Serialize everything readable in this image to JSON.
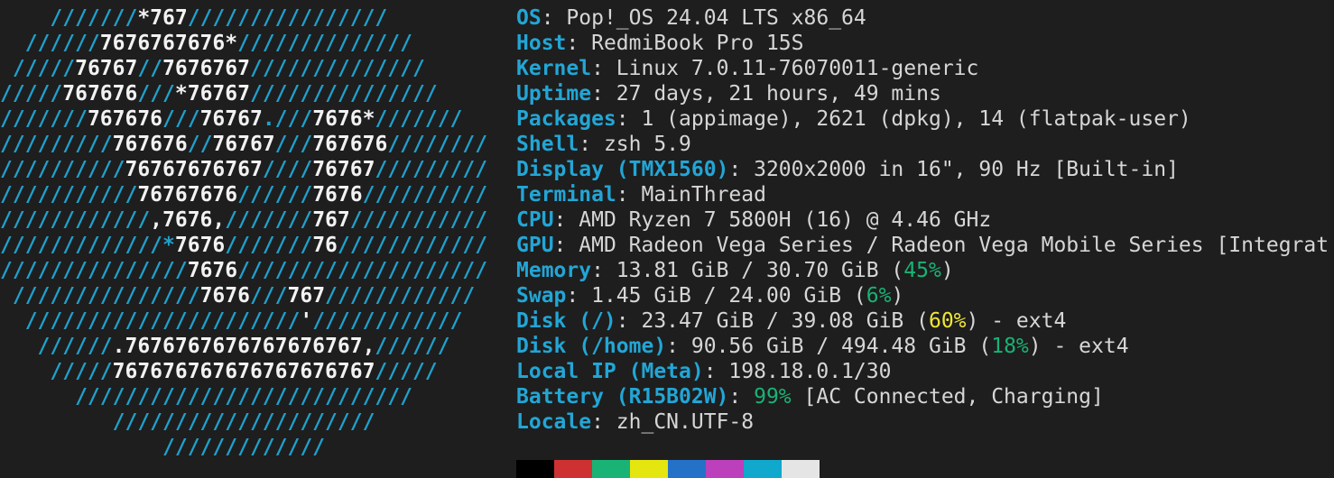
{
  "logo": {
    "lines": [
      [
        {
          "t": "    ///////",
          "c": "c"
        },
        {
          "t": "*767",
          "c": "w"
        },
        {
          "t": "////////////////",
          "c": "c"
        }
      ],
      [
        {
          "t": "  //////",
          "c": "c"
        },
        {
          "t": "7676767676*",
          "c": "w"
        },
        {
          "t": "//////////////",
          "c": "c"
        }
      ],
      [
        {
          "t": " /////",
          "c": "c"
        },
        {
          "t": "76767",
          "c": "w"
        },
        {
          "t": "//",
          "c": "c"
        },
        {
          "t": "7676767",
          "c": "w"
        },
        {
          "t": "//////////////",
          "c": "c"
        }
      ],
      [
        {
          "t": "/////",
          "c": "c"
        },
        {
          "t": "767676",
          "c": "w"
        },
        {
          "t": "///",
          "c": "c"
        },
        {
          "t": "*76767",
          "c": "w"
        },
        {
          "t": "///////////////",
          "c": "c"
        }
      ],
      [
        {
          "t": "///////",
          "c": "c"
        },
        {
          "t": "767676",
          "c": "w"
        },
        {
          "t": "///",
          "c": "c"
        },
        {
          "t": "76767",
          "c": "w"
        },
        {
          "t": ".///",
          "c": "c"
        },
        {
          "t": "7676*",
          "c": "w"
        },
        {
          "t": "///////",
          "c": "c"
        }
      ],
      [
        {
          "t": "/////////",
          "c": "c"
        },
        {
          "t": "767676",
          "c": "w"
        },
        {
          "t": "//",
          "c": "c"
        },
        {
          "t": "76767",
          "c": "w"
        },
        {
          "t": "///",
          "c": "c"
        },
        {
          "t": "767676",
          "c": "w"
        },
        {
          "t": "////////",
          "c": "c"
        }
      ],
      [
        {
          "t": "//////////",
          "c": "c"
        },
        {
          "t": "76767676767",
          "c": "w"
        },
        {
          "t": "////",
          "c": "c"
        },
        {
          "t": "76767",
          "c": "w"
        },
        {
          "t": "/////////",
          "c": "c"
        }
      ],
      [
        {
          "t": "///////////",
          "c": "c"
        },
        {
          "t": "76767676",
          "c": "w"
        },
        {
          "t": "//////",
          "c": "c"
        },
        {
          "t": "7676",
          "c": "w"
        },
        {
          "t": "//////////",
          "c": "c"
        }
      ],
      [
        {
          "t": "////////////",
          "c": "c"
        },
        {
          "t": ",7676,",
          "c": "w"
        },
        {
          "t": "///////",
          "c": "c"
        },
        {
          "t": "767",
          "c": "w"
        },
        {
          "t": "///////////",
          "c": "c"
        }
      ],
      [
        {
          "t": "/////////////",
          "c": "c"
        },
        {
          "t": "*",
          "c": "c"
        },
        {
          "t": "7676",
          "c": "w"
        },
        {
          "t": "///////",
          "c": "c"
        },
        {
          "t": "76",
          "c": "w"
        },
        {
          "t": "////////////",
          "c": "c"
        }
      ],
      [
        {
          "t": "///////////////",
          "c": "c"
        },
        {
          "t": "7676",
          "c": "w"
        },
        {
          "t": "////////////////////",
          "c": "c"
        }
      ],
      [
        {
          "t": " ///////////////",
          "c": "c"
        },
        {
          "t": "7676",
          "c": "w"
        },
        {
          "t": "///",
          "c": "c"
        },
        {
          "t": "767",
          "c": "w"
        },
        {
          "t": "////////////",
          "c": "c"
        }
      ],
      [
        {
          "t": "  //////////////////////",
          "c": "c"
        },
        {
          "t": "'",
          "c": "w"
        },
        {
          "t": "////////////",
          "c": "c"
        }
      ],
      [
        {
          "t": "   //////",
          "c": "c"
        },
        {
          "t": ".7676767676767676767,",
          "c": "w"
        },
        {
          "t": "//////",
          "c": "c"
        }
      ],
      [
        {
          "t": "    /////",
          "c": "c"
        },
        {
          "t": "767676767676767676767",
          "c": "w"
        },
        {
          "t": "/////",
          "c": "c"
        }
      ],
      [
        {
          "t": "      ///////////////////////////",
          "c": "c"
        }
      ],
      [
        {
          "t": "         /////////////////////",
          "c": "c"
        }
      ],
      [
        {
          "t": "             /////////////",
          "c": "c"
        }
      ]
    ]
  },
  "info": [
    {
      "key": "OS",
      "value": [
        {
          "t": "Pop!_OS 24.04 LTS x86_64"
        }
      ]
    },
    {
      "key": "Host",
      "value": [
        {
          "t": "RedmiBook Pro 15S"
        }
      ]
    },
    {
      "key": "Kernel",
      "value": [
        {
          "t": "Linux 7.0.11-76070011-generic"
        }
      ]
    },
    {
      "key": "Uptime",
      "value": [
        {
          "t": "27 days, 21 hours, 49 mins"
        }
      ]
    },
    {
      "key": "Packages",
      "value": [
        {
          "t": "1 (appimage), 2621 (dpkg), 14 (flatpak-user)"
        }
      ]
    },
    {
      "key": "Shell",
      "value": [
        {
          "t": "zsh 5.9"
        }
      ]
    },
    {
      "key": "Display (TMX1560)",
      "value": [
        {
          "t": "3200x2000 in 16\", 90 Hz [Built-in]"
        }
      ]
    },
    {
      "key": "Terminal",
      "value": [
        {
          "t": "MainThread"
        }
      ]
    },
    {
      "key": "CPU",
      "value": [
        {
          "t": "AMD Ryzen 7 5800H (16) @ 4.46 GHz"
        }
      ]
    },
    {
      "key": "GPU",
      "value": [
        {
          "t": "AMD Radeon Vega Series / Radeon Vega Mobile Series [Integrat"
        }
      ]
    },
    {
      "key": "Memory",
      "value": [
        {
          "t": "13.81 GiB / 30.70 GiB ("
        },
        {
          "t": "45%",
          "cls": "green"
        },
        {
          "t": ")"
        }
      ]
    },
    {
      "key": "Swap",
      "value": [
        {
          "t": "1.45 GiB / 24.00 GiB ("
        },
        {
          "t": "6%",
          "cls": "green"
        },
        {
          "t": ")"
        }
      ]
    },
    {
      "key": "Disk (/)",
      "value": [
        {
          "t": "23.47 GiB / 39.08 GiB ("
        },
        {
          "t": "60%",
          "cls": "yellow"
        },
        {
          "t": ") - ext4"
        }
      ]
    },
    {
      "key": "Disk (/home)",
      "value": [
        {
          "t": "90.56 GiB / 494.48 GiB ("
        },
        {
          "t": "18%",
          "cls": "green"
        },
        {
          "t": ") - ext4"
        }
      ]
    },
    {
      "key": "Local IP (Meta)",
      "value": [
        {
          "t": "198.18.0.1/30"
        }
      ]
    },
    {
      "key": "Battery (R15B02W)",
      "value": [
        {
          "t": "99%",
          "cls": "green"
        },
        {
          "t": " [AC Connected, Charging]"
        }
      ]
    },
    {
      "key": "Locale",
      "value": [
        {
          "t": "zh_CN.UTF-8"
        }
      ]
    }
  ],
  "palette": [
    "#000000",
    "#cd3131",
    "#18b375",
    "#e5e510",
    "#2472c8",
    "#bc3fbc",
    "#11a8cd",
    "#e5e5e5"
  ],
  "colors": {
    "accent_key": "#22a6d6",
    "logo_cyan": "#1fa1cd",
    "ok_green": "#18b375",
    "warn_yellow": "#f0e635",
    "background": "#1e1e1e"
  }
}
